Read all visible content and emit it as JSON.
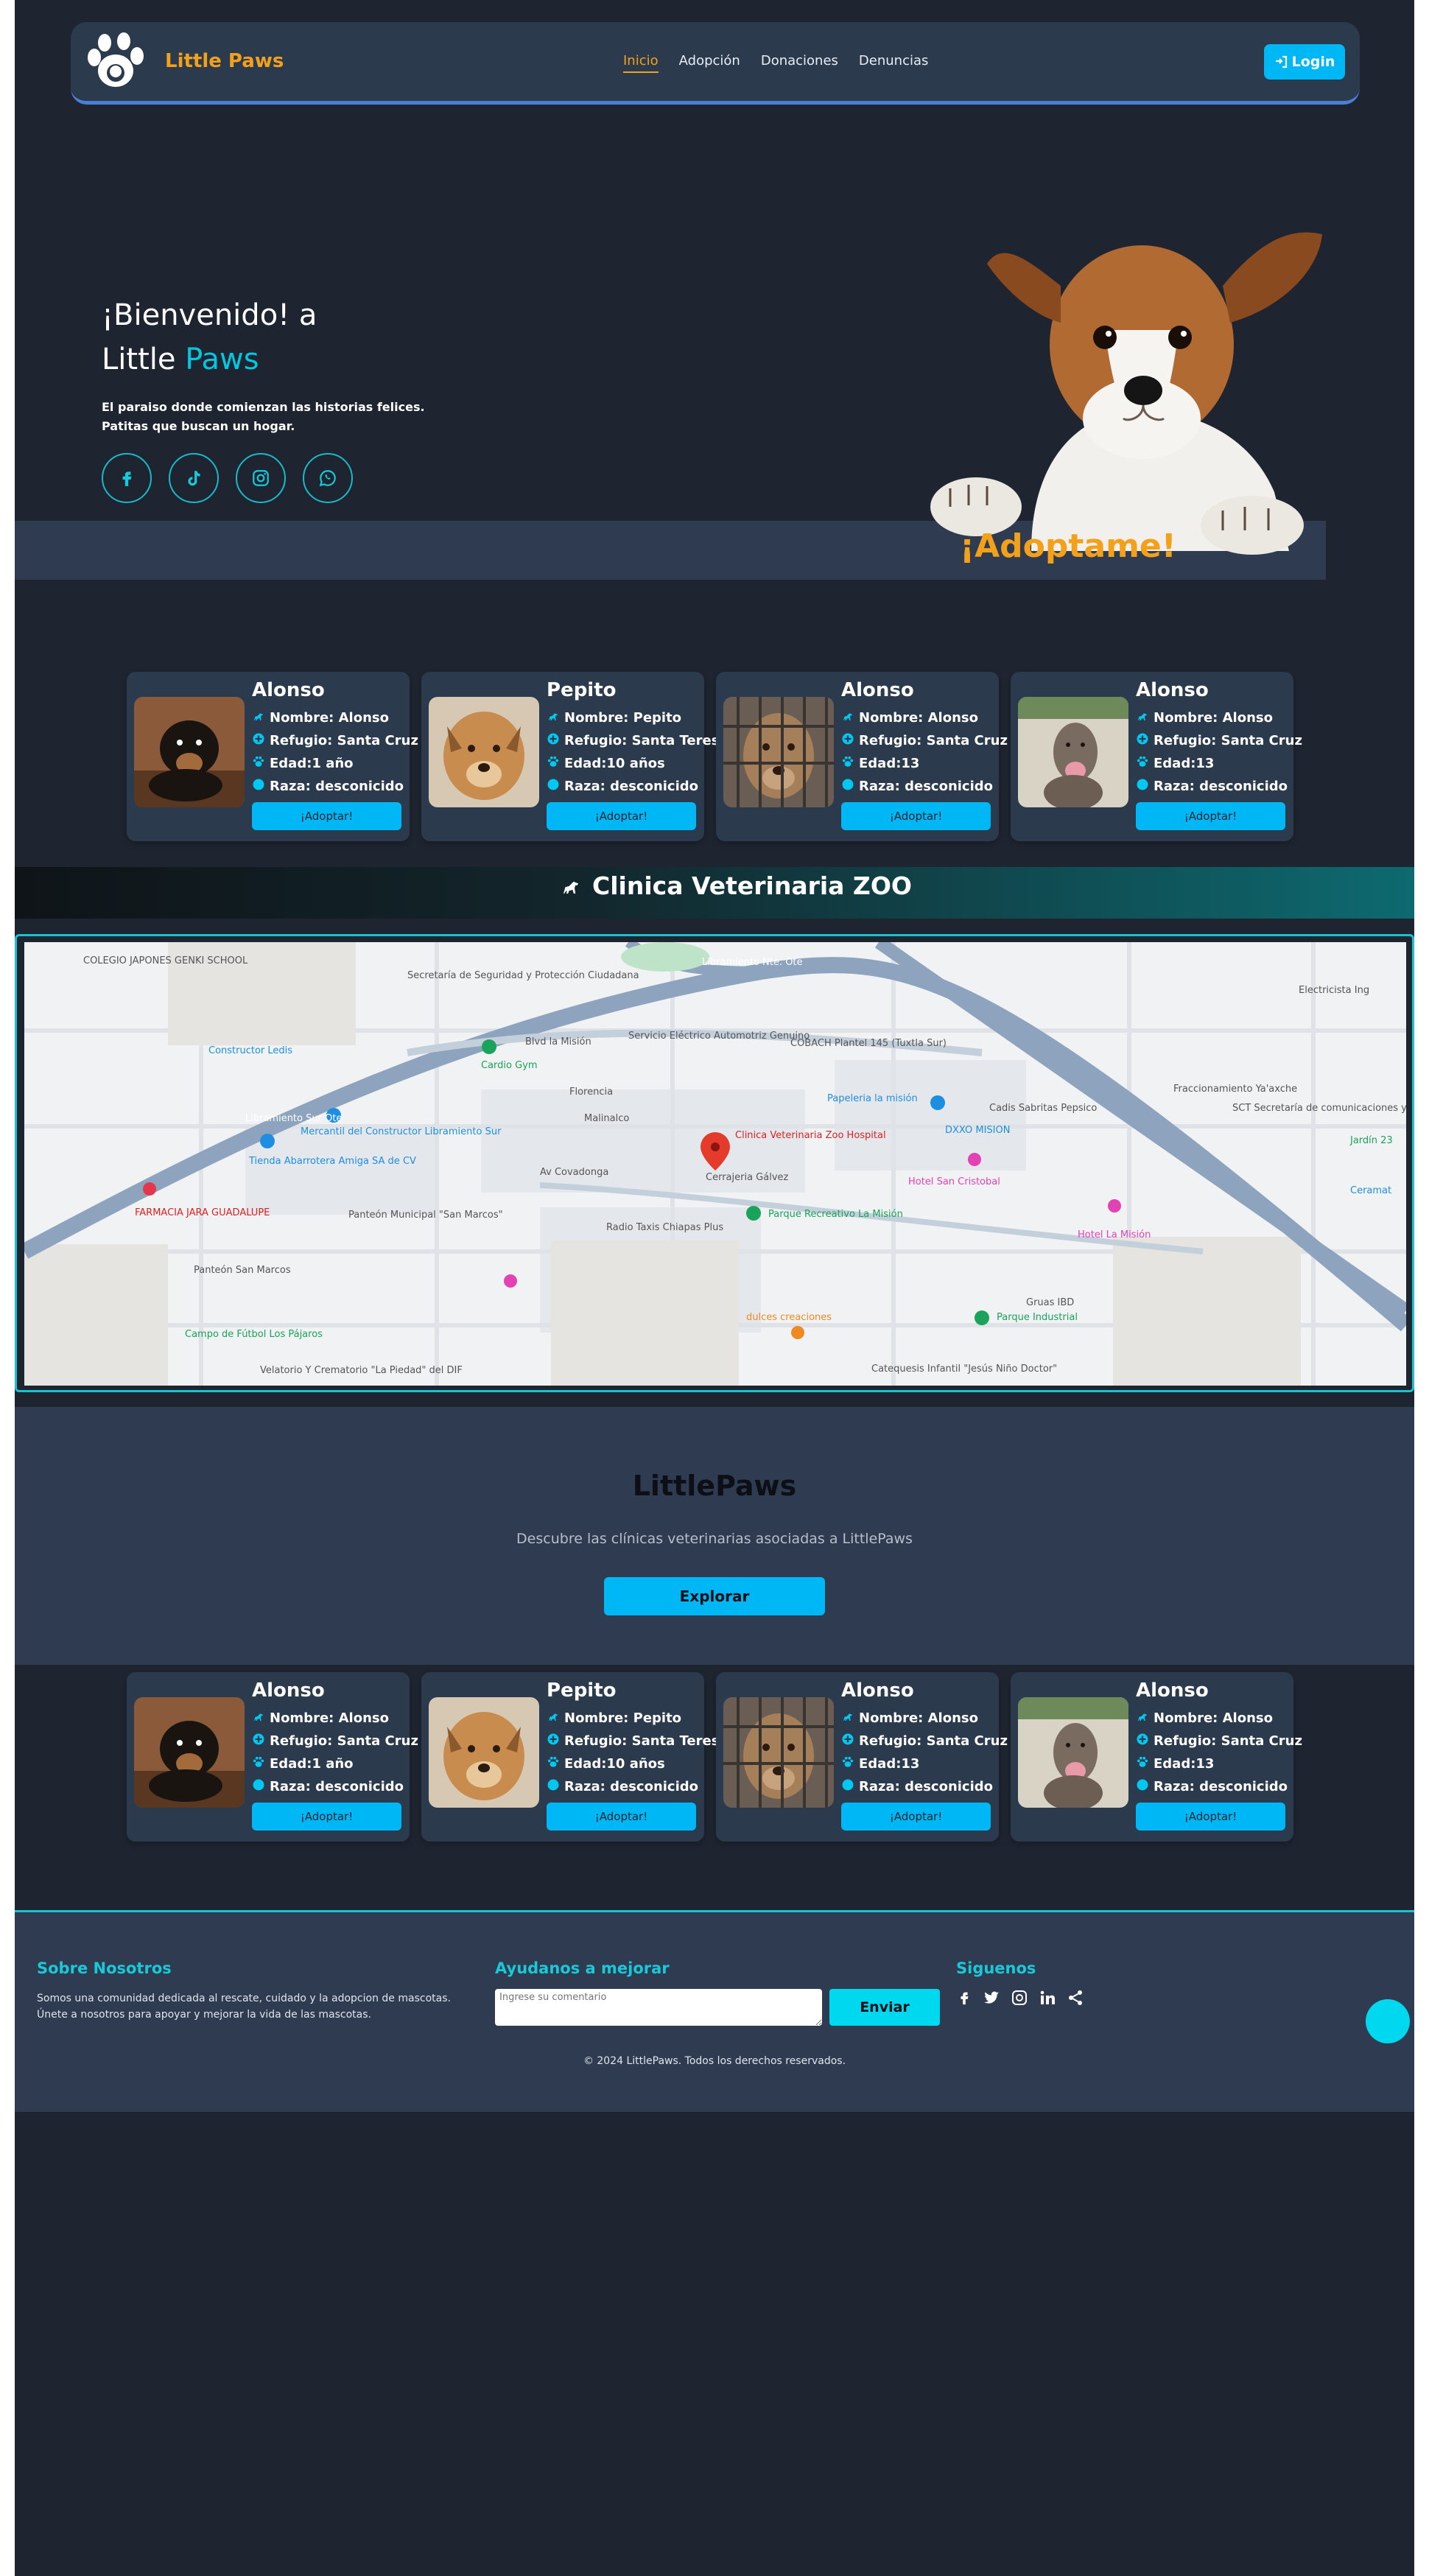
{
  "nav": {
    "brand": "Little Paws",
    "links": [
      "Inicio",
      "Adopción",
      "Donaciones",
      "Denuncias"
    ],
    "login": "Login"
  },
  "hero": {
    "title_line1": "¡Bienvenido! a",
    "title_line2_a": "Little ",
    "title_line2_b": "Paws",
    "desc_line1": "El paraiso donde comienzan las historias felices.",
    "desc_line2": "Patitas que buscan un hogar.",
    "socials": [
      "facebook-icon",
      "tiktok-icon",
      "instagram-icon",
      "whatsapp-icon"
    ],
    "adopt": "¡Adoptame!"
  },
  "cards_top": [
    {
      "name": "Alonso",
      "nombre": "Nombre: Alonso",
      "refugio": "Refugio: Santa Cruz",
      "edad": "Edad:1 año",
      "raza": "Raza: desconicido",
      "button": "¡Adoptar!"
    },
    {
      "name": "Pepito",
      "nombre": "Nombre: Pepito",
      "refugio": "Refugio: Santa Teresa",
      "edad": "Edad:10 años",
      "raza": "Raza: desconicido",
      "button": "¡Adoptar!"
    },
    {
      "name": "Alonso",
      "nombre": "Nombre: Alonso",
      "refugio": "Refugio: Santa Cruz",
      "edad": "Edad:13",
      "raza": "Raza: desconicido",
      "button": "¡Adoptar!"
    },
    {
      "name": "Alonso",
      "nombre": "Nombre: Alonso",
      "refugio": "Refugio: Santa Cruz",
      "edad": "Edad:13",
      "raza": "Raza: desconicido",
      "button": "¡Adoptar!"
    }
  ],
  "clinic": {
    "title": "Clinica Veterinaria ZOO",
    "map_labels": [
      "COLEGIO JAPONES GENKI SCHOOL",
      "Secretaría de Seguridad y Protección Ciudadana",
      "Constructor Ledis",
      "Cardio Gym",
      "Servicio Eléctrico Automotriz Genuino",
      "COBACH Plantel 145 (Tuxtla Sur)",
      "Papeleria la misión",
      "Clinica Veterinaria Zoo Hospital",
      "Cerrajeria Gálvez",
      "Mercantil del Constructor Libramiento Sur",
      "Tienda Abarrotera Amiga SA de CV",
      "Panteón Municipal \"San Marcos\"",
      "Radio Taxis Chiapas Plus",
      "Parque Recreativo La Misión",
      "Hotel San Cristobal",
      "DXXO MISION",
      "Cadis Sabritas Pepsico",
      "Hotel La Misión",
      "Parque Industrial",
      "Campo de Fútbol Los Pájaros",
      "dulces creaciones",
      "Velatorio Y Crematorio \"La Piedad\" del DIF",
      "Catequesis Infantil \"Jesús Niño Doctor\"",
      "SCT Secretaría de comunicaciones y",
      "Electricista Ing",
      "Jardín 23",
      "Ceramat",
      "FARMACIA JARA GUADALUPE",
      "Libramiento Sur Ote",
      "Libramiento Nte. Ote",
      "Blvd la Misión",
      "Av Covadonga",
      "Panteón San Marcos",
      "Fraccionamiento Ya'axche",
      "Gruas IBD",
      "Malinalco",
      "Florencia"
    ]
  },
  "littlepaws": {
    "title": "LittlePaws",
    "subtitle": "Descubre las clínicas veterinarias asociadas a LittlePaws",
    "button": "Explorar"
  },
  "cards_bottom": [
    {
      "name": "Alonso",
      "nombre": "Nombre: Alonso",
      "refugio": "Refugio: Santa Cruz",
      "edad": "Edad:1 año",
      "raza": "Raza: desconicido",
      "button": "¡Adoptar!"
    },
    {
      "name": "Pepito",
      "nombre": "Nombre: Pepito",
      "refugio": "Refugio: Santa Teresa",
      "edad": "Edad:10 años",
      "raza": "Raza: desconicido",
      "button": "¡Adoptar!"
    },
    {
      "name": "Alonso",
      "nombre": "Nombre: Alonso",
      "refugio": "Refugio: Santa Cruz",
      "edad": "Edad:13",
      "raza": "Raza: desconicido",
      "button": "¡Adoptar!"
    },
    {
      "name": "Alonso",
      "nombre": "Nombre: Alonso",
      "refugio": "Refugio: Santa Cruz",
      "edad": "Edad:13",
      "raza": "Raza: desconicido",
      "button": "¡Adoptar!"
    }
  ],
  "footer": {
    "about_title": "Sobre Nosotros",
    "about_text": "Somos una comunidad dedicada al rescate, cuidado y la adopcion de mascotas. Únete a nosotros para apoyar y mejorar la vida de las mascotas.",
    "help_title": "Ayudanos a mejorar",
    "comment_placeholder": "Ingrese su comentario",
    "send": "Enviar",
    "follow_title": "Siguenos",
    "follow_icons": [
      "facebook-icon",
      "twitter-icon",
      "instagram-icon",
      "linkedin-icon",
      "share-icon"
    ],
    "copyright": "© 2024 LittlePaws. Todos los derechos reservados."
  },
  "colors": {
    "page_bg": "#1f2530",
    "panel": "#2c3a4e",
    "accent_orange": "#f3a01b",
    "accent_cyan": "#00c8e0",
    "button_blue": "#00b7f5"
  }
}
